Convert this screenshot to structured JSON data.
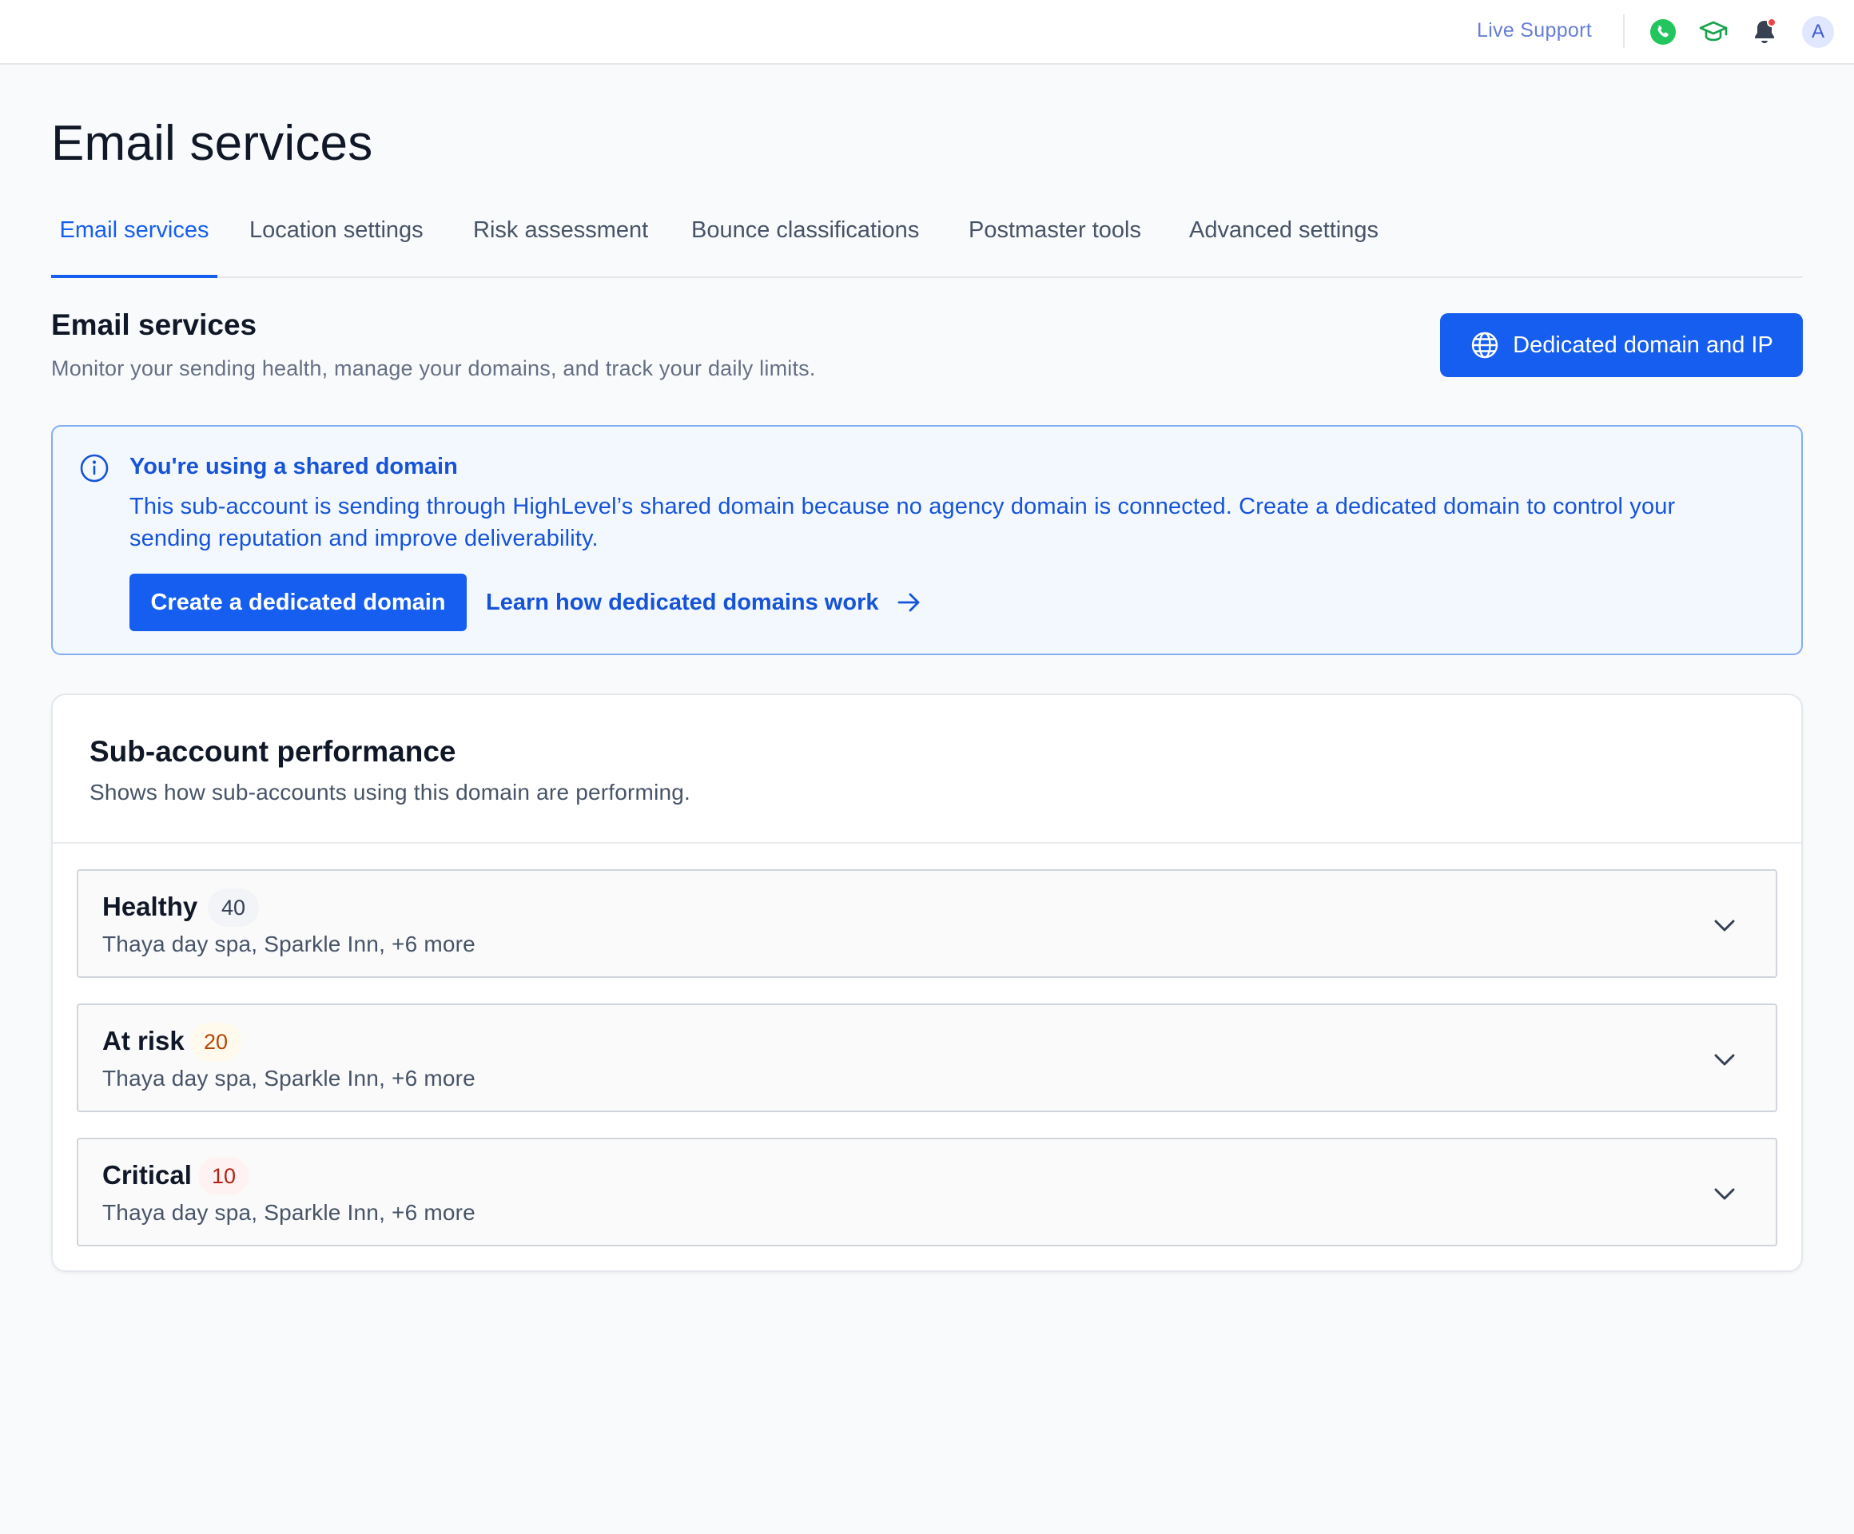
{
  "topbar": {
    "live_support": "Live Support",
    "avatar_initial": "A",
    "colors": {
      "phone": "#22c55e",
      "cap": "#16a34a",
      "bell_dot": "#ef4444"
    }
  },
  "page": {
    "title": "Email services"
  },
  "tabs": [
    {
      "label": "Email services",
      "active": true
    },
    {
      "label": "Location settings",
      "active": false
    },
    {
      "label": "Risk assessment",
      "active": false
    },
    {
      "label": "Bounce classifications",
      "active": false
    },
    {
      "label": "Postmaster tools",
      "active": false
    },
    {
      "label": "Advanced settings",
      "active": false
    }
  ],
  "section": {
    "title": "Email services",
    "subtitle": "Monitor your sending health, manage your domains, and track your daily limits.",
    "primary_button": "Dedicated domain and IP"
  },
  "banner": {
    "title": "You're using a shared domain",
    "text": "This sub-account is sending through HighLevel’s shared domain because no agency domain is connected. Create a dedicated domain to control your sending reputation and improve deliverability.",
    "create_button": "Create a dedicated domain",
    "learn_link": "Learn how dedicated domains work"
  },
  "performance": {
    "title": "Sub-account performance",
    "subtitle": "Shows how sub-accounts using this domain are performing.",
    "groups": [
      {
        "name": "Healthy",
        "count": "40",
        "accounts": "Thaya day spa, Sparkle Inn, +6 more"
      },
      {
        "name": "At risk",
        "count": "20",
        "accounts": "Thaya day spa, Sparkle Inn, +6 more"
      },
      {
        "name": "Critical",
        "count": "10",
        "accounts": "Thaya day spa, Sparkle Inn, +6 more"
      }
    ]
  },
  "colors": {
    "accent": "#155eef",
    "banner_bg": "#f3f7fe",
    "banner_border": "#84adf4"
  }
}
